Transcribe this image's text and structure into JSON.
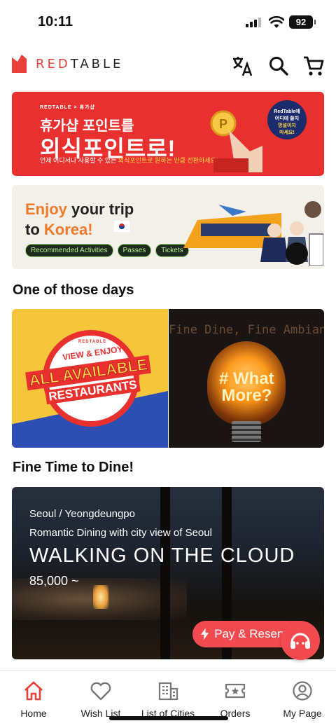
{
  "status_bar": {
    "time": "10:11",
    "battery": "92"
  },
  "header": {
    "logo_red": "RED",
    "logo_rest": "TABLE",
    "icons": [
      "translate-icon",
      "search-icon",
      "cart-icon"
    ]
  },
  "banners": [
    {
      "small": "REDTABLE × 휴가샵",
      "line1": "휴가샵 포인트를",
      "line2": "외식포인트로!",
      "sub_a": "언제 어디서나 사용할 수 있는 ",
      "sub_b": "외식포인트로 원하는 만큼 전환하세요!",
      "bubble_a": "RedTable에",
      "bubble_b": "어디에 쓸지",
      "bubble_c": "망설이지",
      "bubble_d": "마세요!"
    },
    {
      "line1_a": "Enjoy",
      "line1_b": " your trip",
      "line2_a": "to ",
      "line2_b": "Korea!",
      "pills": [
        "Recommended Activities",
        "Passes",
        "Tickets"
      ]
    }
  ],
  "section_days": {
    "title": "One of those days",
    "left": {
      "brand": "REDTABLE",
      "l1": "VIEW & ENJOY",
      "l2": "ALL AVAILABLE",
      "l3": "RESTAURANTS"
    },
    "right": {
      "header": "Fine Dine, Fine Ambiance",
      "l1": "# What",
      "l2": "More?"
    }
  },
  "section_fine": {
    "title": "Fine Time to Dine!",
    "card": {
      "location": "Seoul / Yeongdeungpo",
      "description": "Romantic Dining with city view of Seoul",
      "name": "WALKING ON THE CLOUD",
      "price": "85,000 ~"
    }
  },
  "pay_button": "Pay & Reservation",
  "nav": [
    {
      "label": "Home",
      "icon": "home-icon",
      "active": true
    },
    {
      "label": "Wish List",
      "icon": "heart-icon",
      "active": false
    },
    {
      "label": "List of Cities",
      "icon": "building-icon",
      "active": false
    },
    {
      "label": "Orders",
      "icon": "ticket-icon",
      "active": false
    },
    {
      "label": "My Page",
      "icon": "user-circle-icon",
      "active": false
    }
  ],
  "colors": {
    "brand_red": "#e8413a",
    "pay_red": "#f24a4f",
    "pill_green": "#b8f08c"
  }
}
